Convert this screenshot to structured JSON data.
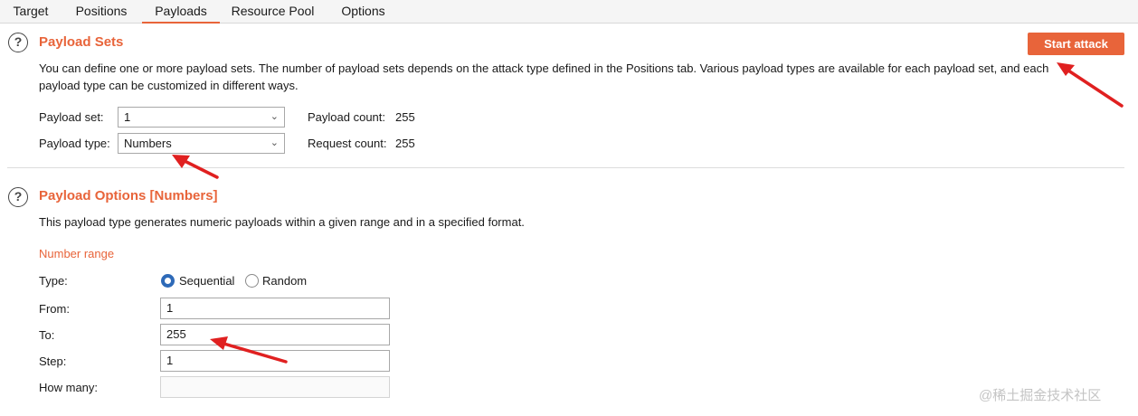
{
  "tabs": [
    "Target",
    "Positions",
    "Payloads",
    "Resource Pool",
    "Options"
  ],
  "active_tab": "Payloads",
  "payload_sets": {
    "title": "Payload Sets",
    "description_line1": "You can define one or more payload sets. The number of payload sets depends on the attack type defined in the Positions tab. Various payload types are available for each payload set, and each",
    "description_line2": "payload type can be customized in different ways.",
    "payload_set_label": "Payload set:",
    "payload_set_value": "1",
    "payload_type_label": "Payload type:",
    "payload_type_value": "Numbers",
    "payload_count_label": "Payload count:",
    "payload_count_value": "255",
    "request_count_label": "Request count:",
    "request_count_value": "255",
    "start_attack_label": "Start attack"
  },
  "payload_options": {
    "title": "Payload Options [Numbers]",
    "description": "This payload type generates numeric payloads within a given range and in a specified format.",
    "number_range_label": "Number range",
    "type_label": "Type:",
    "sequential_label": "Sequential",
    "random_label": "Random",
    "selected_type": "Sequential",
    "from_label": "From:",
    "from_value": "1",
    "to_label": "To:",
    "to_value": "255",
    "step_label": "Step:",
    "step_value": "1",
    "how_many_label": "How many:",
    "how_many_value": ""
  },
  "icons": {
    "help": "question-circle-icon",
    "dropdown": "chevron-down-icon",
    "annotation": "red-arrow-annotation"
  },
  "colors": {
    "accent": "#e8643a",
    "radio_selected": "#2e6ab8",
    "annotation": "#e02020"
  },
  "watermark": "@稀土掘金技术社区"
}
